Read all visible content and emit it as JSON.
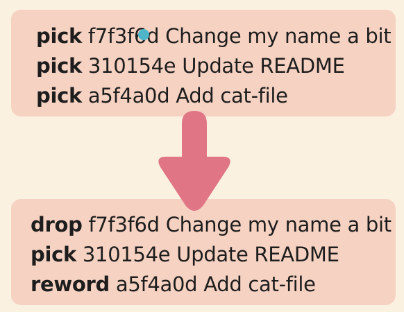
{
  "top_panel": {
    "lines": [
      {
        "command": "pick",
        "hash": "f7f3f6d",
        "message": "Change my name a bit"
      },
      {
        "command": "pick",
        "hash": "310154e",
        "message": "Update README"
      },
      {
        "command": "pick",
        "hash": "a5f4a0d",
        "message": "Add cat-file"
      }
    ]
  },
  "bottom_panel": {
    "lines": [
      {
        "command": "drop",
        "hash": "f7f3f6d",
        "message": "Change my name a bit"
      },
      {
        "command": "pick",
        "hash": "310154e",
        "message": "Update README"
      },
      {
        "command": "reword",
        "hash": "a5f4a0d",
        "message": "Add cat-file"
      }
    ]
  },
  "colors": {
    "background": "#fbf1e1",
    "panel": "#f6d2c2",
    "arrow": "#e07585",
    "cursor": "#4fb6c9",
    "text": "#1d1d1d"
  },
  "icons": {
    "arrow": "arrow-down-icon",
    "cursor": "cursor-dot-icon"
  }
}
